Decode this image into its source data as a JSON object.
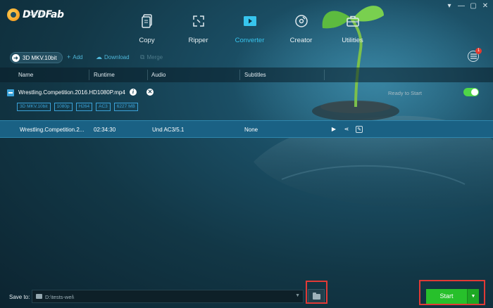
{
  "app": {
    "brand": "DVDFab",
    "version": "10.0.6.8",
    "window_controls": [
      "▾",
      "—",
      "▢",
      "✕"
    ]
  },
  "modules": [
    {
      "label": "Copy",
      "icon": "copy-icon",
      "active": false
    },
    {
      "label": "Ripper",
      "icon": "ripper-icon",
      "active": false
    },
    {
      "label": "Converter",
      "icon": "converter-icon",
      "active": true
    },
    {
      "label": "Creator",
      "icon": "creator-icon",
      "active": false
    },
    {
      "label": "Utilities",
      "icon": "utilities-icon",
      "active": false
    }
  ],
  "toolbar": {
    "profile": "3D MKV.10bit",
    "add": "Add",
    "download": "Download",
    "merge": "Merge",
    "queue_badge": "1"
  },
  "columns": {
    "name": "Name",
    "runtime": "Runtime",
    "audio": "Audio",
    "subtitles": "Subtitles"
  },
  "source": {
    "filename": "Wrestling.Competition.2016.HD1080P.mp4",
    "status": "Ready to Start",
    "enabled": true,
    "tags": [
      "3D MKV.10bit",
      "1080p",
      "H264",
      "AC3",
      "6227 MB"
    ]
  },
  "track": {
    "name": "Wrestling.Competition.2...",
    "runtime": "02:34:30",
    "audio": "Und AC3/5.1",
    "subtitles": "None"
  },
  "bottom": {
    "save_label": "Save to:",
    "path": "D:\\tests-wei\\",
    "start": "Start"
  },
  "colors": {
    "accent": "#37c5ee",
    "start_green": "#27c02b",
    "toggle_green": "#4fd648",
    "highlight_red": "#e13a36",
    "badge_red": "#e23a2f"
  }
}
